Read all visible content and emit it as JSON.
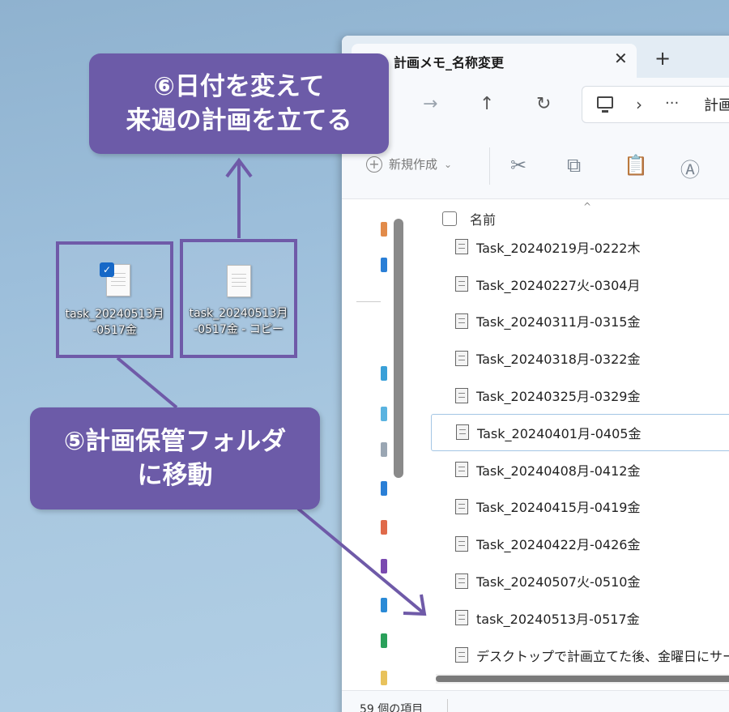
{
  "window": {
    "tab_title": "計画メモ_名称変更",
    "tab_close": "✕",
    "tab_new": "+"
  },
  "nav": {
    "forward": "→",
    "up": "↑",
    "refresh": "↻",
    "chevron": "›",
    "ellipsis": "···",
    "path_fragment": "計画"
  },
  "toolbar": {
    "new_label": "新規作成",
    "new_chevron": "⌄",
    "plus": "+"
  },
  "list": {
    "sort_caret": "^",
    "column_name": "名前",
    "files": [
      "Task_20240219月-0222木",
      "Task_20240227火-0304月",
      "Task_20240311月-0315金",
      "Task_20240318月-0322金",
      "Task_20240325月-0329金",
      "Task_20240401月-0405金",
      "Task_20240408月-0412金",
      "Task_20240415月-0419金",
      "Task_20240422月-0426金",
      "Task_20240507火-0510金",
      "task_20240513月-0517金",
      "デスクトップで計画立てた後、金曜日にサー..."
    ],
    "selected_index": 5
  },
  "status": {
    "item_count": "59 個の項目"
  },
  "desktop": {
    "icon_a_line1": "task_20240513月",
    "icon_a_line2": "-0517金",
    "icon_b_line1": "task_20240513月",
    "icon_b_line2": "-0517金 - コピー"
  },
  "callouts": {
    "top_line1": "⑥日付を変えて",
    "top_line2": "来週の計画を立てる",
    "mid_line1": "⑤計画保管フォルダ",
    "mid_line2": "に移動"
  },
  "colors": {
    "accent_purple": "#6c5ba8",
    "box_border": "#6f5aa8",
    "check_blue": "#1668c7"
  }
}
